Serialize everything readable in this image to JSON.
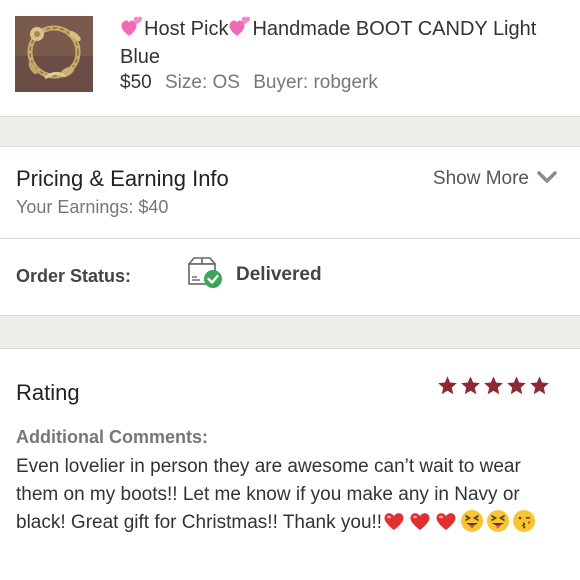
{
  "listing": {
    "badge": "Host Pick",
    "title": "Handmade BOOT CANDY Light Blue",
    "price": "$50",
    "size": "Size: OS",
    "buyer": "Buyer: robgerk",
    "thumbnail_icon": "product-photo"
  },
  "pricing": {
    "title": "Pricing & Earning Info",
    "earnings": "Your Earnings: $40",
    "show_more": "Show More"
  },
  "order": {
    "label": "Order Status:",
    "value": "Delivered",
    "icon": "delivered-box-icon"
  },
  "rating": {
    "title": "Rating",
    "stars": 5,
    "max_stars": 5,
    "star_color": "#8c2a33",
    "comments_label": "Additional Comments:",
    "comment": "Even lovelier in person they are awesome can’t wait to wear them on my boots!! Let me know if you make any in Navy or black! Great gift for Christmas!! Thank you!!",
    "emojis": [
      "red-heart",
      "red-heart",
      "red-heart",
      "squinting-tongue",
      "squinting-tongue",
      "kissing-face"
    ]
  },
  "colors": {
    "band": "#efeeea",
    "accent_green": "#3aa65a",
    "star": "#8c2a33"
  }
}
